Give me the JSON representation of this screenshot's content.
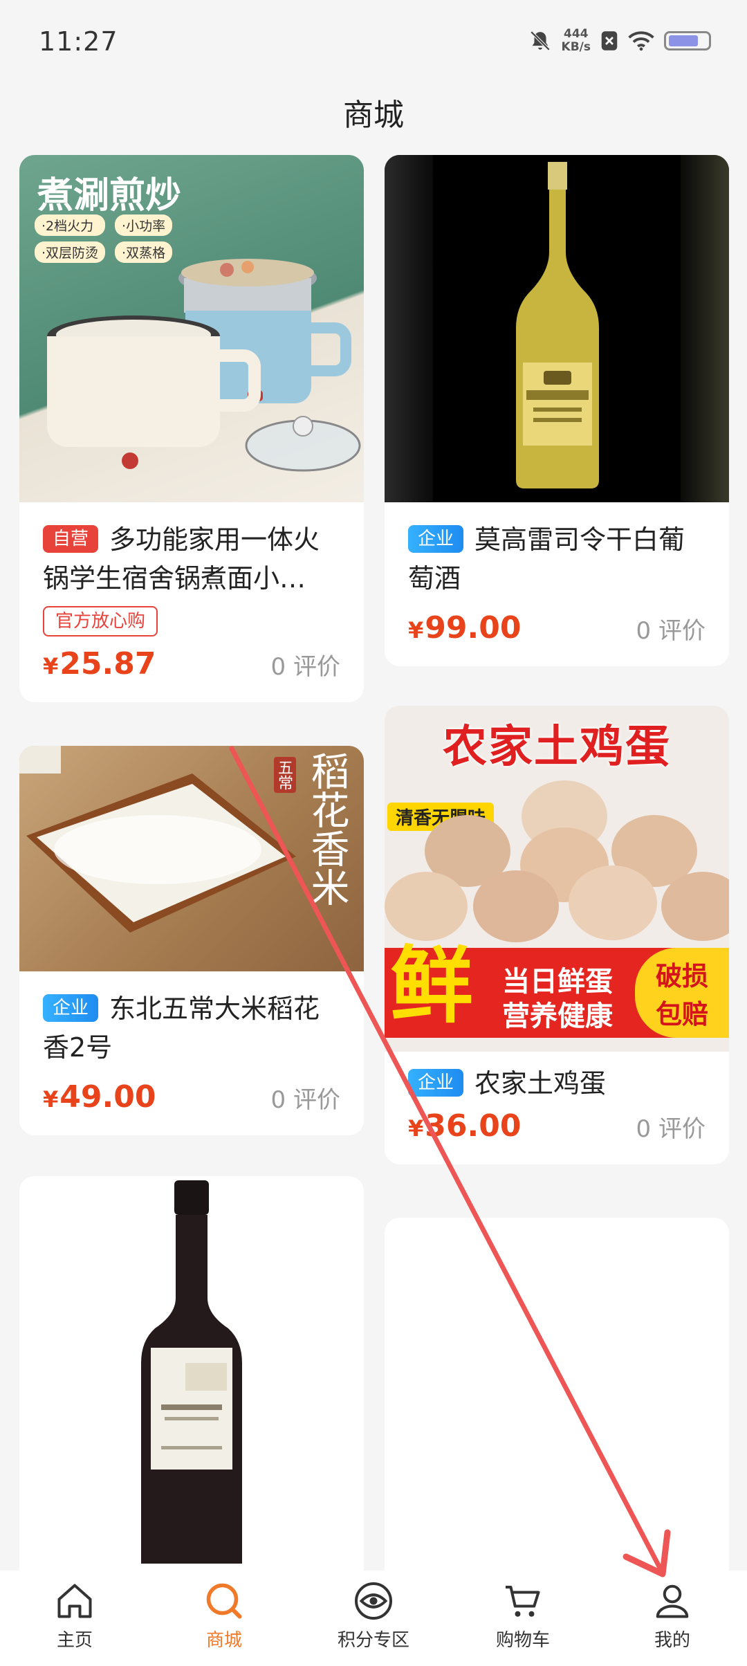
{
  "status_bar": {
    "time": "11:27",
    "net_speed_value": "444",
    "net_speed_unit": "KB/s"
  },
  "page_title": "商城",
  "products": [
    {
      "tag": "自营",
      "title": "多功能家用一体火锅学生宿舍锅煮面小…",
      "badge": "官方放心购",
      "currency": "¥",
      "price": "25.87",
      "reviews": "0 评价",
      "image_text": {
        "headline": "煮涮煎炒",
        "features": [
          "·2档火力",
          "·小功率",
          "·双层防烫",
          "·双蒸格"
        ]
      }
    },
    {
      "tag": "企业",
      "title": "莫高雷司令干白葡萄酒",
      "currency": "¥",
      "price": "99.00",
      "reviews": "0 评价"
    },
    {
      "tag": "企业",
      "title": "东北五常大米稻花香2号",
      "currency": "¥",
      "price": "49.00",
      "reviews": "0 评价",
      "image_text": {
        "vertical": "稻花香米",
        "small": "五常"
      }
    },
    {
      "tag": "企业",
      "title": "农家土鸡蛋",
      "currency": "¥",
      "price": "36.00",
      "reviews": "0 评价",
      "image_text": {
        "headline": "农家土鸡蛋",
        "sub": "清香无腥味",
        "big": "鲜",
        "slogan1": "当日鲜蛋",
        "slogan2": "营养健康",
        "promise1": "破损",
        "promise2": "包赔"
      }
    }
  ],
  "nav": [
    {
      "label": "主页",
      "icon": "home-icon"
    },
    {
      "label": "商城",
      "icon": "search-icon",
      "active": true
    },
    {
      "label": "积分专区",
      "icon": "eye-icon"
    },
    {
      "label": "购物车",
      "icon": "cart-icon"
    },
    {
      "label": "我的",
      "icon": "user-icon"
    }
  ],
  "colors": {
    "accent": "#f07a2a",
    "price": "#e8431b",
    "tag_self": "#e8433b",
    "tag_enterprise": "#1e8cf0",
    "annotation_arrow": "#ee5555"
  }
}
